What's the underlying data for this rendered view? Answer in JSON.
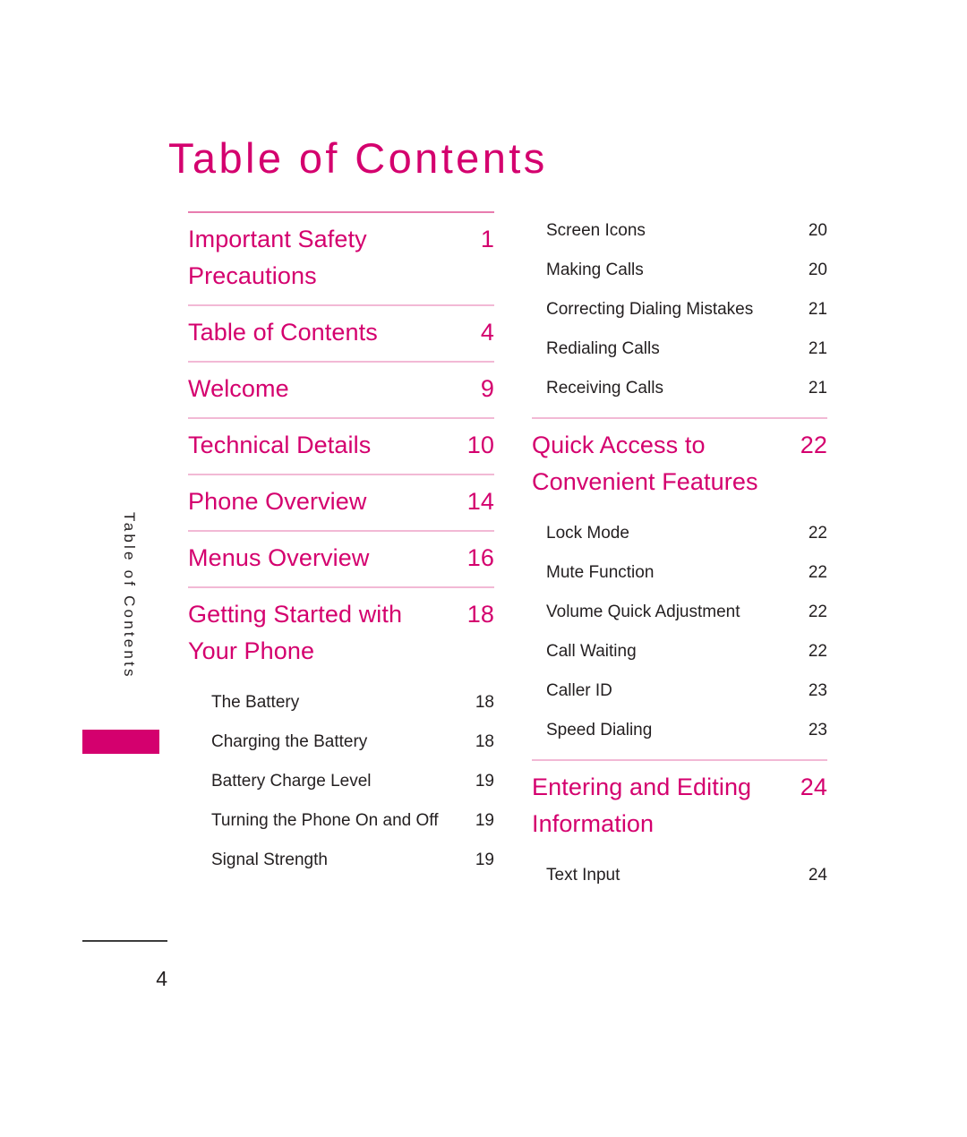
{
  "page": {
    "title": "Table of Contents",
    "side_tab_label": "Table of Contents",
    "footer_page_number": "4",
    "accent_color": "#D4006E",
    "rule_color_strong": "#E87CAF",
    "rule_color_light": "#F2B9D5",
    "text_color": "#231F20"
  },
  "left_column": {
    "sections": [
      {
        "title": "Important Safety Precautions",
        "page": "1",
        "wrap": true,
        "rule": "strong",
        "subentries": []
      },
      {
        "title": "Table of Contents",
        "page": "4",
        "wrap": false,
        "rule": "light",
        "subentries": []
      },
      {
        "title": "Welcome",
        "page": "9",
        "wrap": false,
        "rule": "light",
        "subentries": []
      },
      {
        "title": "Technical Details",
        "page": "10",
        "wrap": false,
        "rule": "light",
        "subentries": []
      },
      {
        "title": "Phone Overview",
        "page": "14",
        "wrap": false,
        "rule": "light",
        "subentries": []
      },
      {
        "title": "Menus Overview",
        "page": "16",
        "wrap": false,
        "rule": "light",
        "subentries": []
      },
      {
        "title": "Getting Started with Your Phone",
        "page": "18",
        "wrap": true,
        "rule": "light",
        "subentries": [
          {
            "title": "The Battery",
            "page": "18"
          },
          {
            "title": "Charging the Battery",
            "page": "18"
          },
          {
            "title": "Battery Charge Level",
            "page": "19"
          },
          {
            "title": "Turning the Phone On and Off",
            "page": "19"
          },
          {
            "title": "Signal Strength",
            "page": "19"
          }
        ]
      }
    ]
  },
  "right_column": {
    "continued_subentries": [
      {
        "title": "Screen Icons",
        "page": "20"
      },
      {
        "title": "Making Calls",
        "page": "20"
      },
      {
        "title": "Correcting Dialing Mistakes",
        "page": "21"
      },
      {
        "title": "Redialing Calls",
        "page": "21"
      },
      {
        "title": "Receiving Calls",
        "page": "21"
      }
    ],
    "sections": [
      {
        "title": "Quick Access to Convenient Features",
        "page": "22",
        "wrap": true,
        "rule": "light",
        "subentries": [
          {
            "title": "Lock Mode",
            "page": "22"
          },
          {
            "title": "Mute Function",
            "page": "22"
          },
          {
            "title": "Volume Quick Adjustment",
            "page": "22"
          },
          {
            "title": "Call Waiting",
            "page": "22"
          },
          {
            "title": "Caller ID",
            "page": "23"
          },
          {
            "title": "Speed Dialing",
            "page": "23"
          }
        ]
      },
      {
        "title": "Entering and Editing Information",
        "page": "24",
        "wrap": true,
        "rule": "light",
        "subentries": [
          {
            "title": "Text Input",
            "page": "24"
          }
        ]
      }
    ]
  }
}
